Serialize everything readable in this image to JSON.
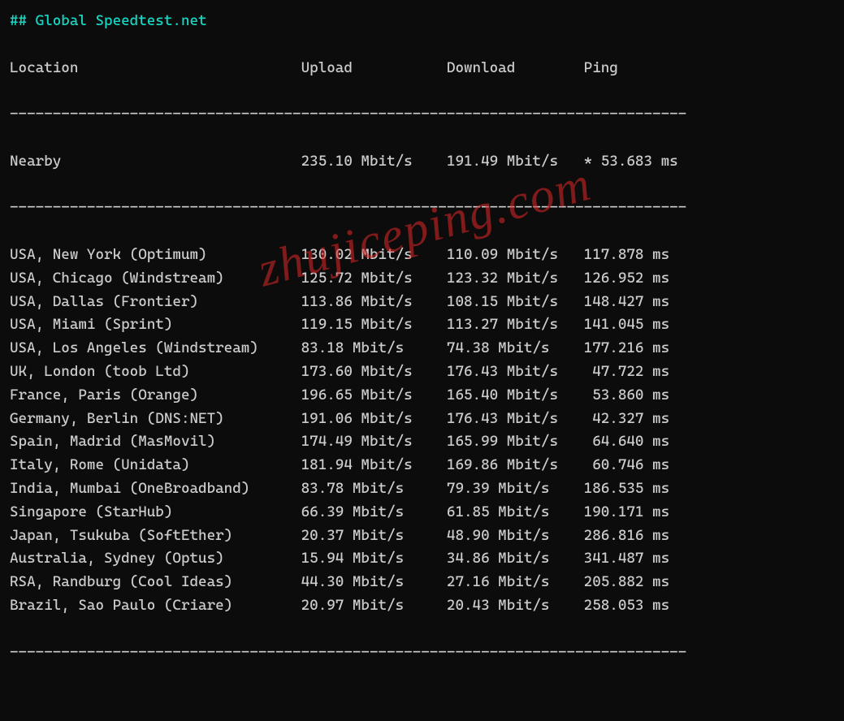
{
  "title": "## Global Speedtest.net",
  "headers": {
    "location": "Location",
    "upload": "Upload",
    "download": "Download",
    "ping": "Ping"
  },
  "nearby": {
    "location": "Nearby",
    "upload": "235.10 Mbit/s",
    "download": "191.49 Mbit/s",
    "ping": "* 53.683 ms"
  },
  "rows": [
    {
      "location": "USA, New York (Optimum)",
      "upload": "130.02 Mbit/s",
      "download": "110.09 Mbit/s",
      "ping": "117.878 ms"
    },
    {
      "location": "USA, Chicago (Windstream)",
      "upload": "125.72 Mbit/s",
      "download": "123.32 Mbit/s",
      "ping": "126.952 ms"
    },
    {
      "location": "USA, Dallas (Frontier)",
      "upload": "113.86 Mbit/s",
      "download": "108.15 Mbit/s",
      "ping": "148.427 ms"
    },
    {
      "location": "USA, Miami (Sprint)",
      "upload": "119.15 Mbit/s",
      "download": "113.27 Mbit/s",
      "ping": "141.045 ms"
    },
    {
      "location": "USA, Los Angeles (Windstream)",
      "upload": "83.18 Mbit/s",
      "download": "74.38 Mbit/s",
      "ping": "177.216 ms"
    },
    {
      "location": "UK, London (toob Ltd)",
      "upload": "173.60 Mbit/s",
      "download": "176.43 Mbit/s",
      "ping": " 47.722 ms"
    },
    {
      "location": "France, Paris (Orange)",
      "upload": "196.65 Mbit/s",
      "download": "165.40 Mbit/s",
      "ping": " 53.860 ms"
    },
    {
      "location": "Germany, Berlin (DNS:NET)",
      "upload": "191.06 Mbit/s",
      "download": "176.43 Mbit/s",
      "ping": " 42.327 ms"
    },
    {
      "location": "Spain, Madrid (MasMovil)",
      "upload": "174.49 Mbit/s",
      "download": "165.99 Mbit/s",
      "ping": " 64.640 ms"
    },
    {
      "location": "Italy, Rome (Unidata)",
      "upload": "181.94 Mbit/s",
      "download": "169.86 Mbit/s",
      "ping": " 60.746 ms"
    },
    {
      "location": "India, Mumbai (OneBroadband)",
      "upload": "83.78 Mbit/s",
      "download": "79.39 Mbit/s",
      "ping": "186.535 ms"
    },
    {
      "location": "Singapore (StarHub)",
      "upload": "66.39 Mbit/s",
      "download": "61.85 Mbit/s",
      "ping": "190.171 ms"
    },
    {
      "location": "Japan, Tsukuba (SoftEther)",
      "upload": "20.37 Mbit/s",
      "download": "48.90 Mbit/s",
      "ping": "286.816 ms"
    },
    {
      "location": "Australia, Sydney (Optus)",
      "upload": "15.94 Mbit/s",
      "download": "34.86 Mbit/s",
      "ping": "341.487 ms"
    },
    {
      "location": "RSA, Randburg (Cool Ideas)",
      "upload": "44.30 Mbit/s",
      "download": "27.16 Mbit/s",
      "ping": "205.882 ms"
    },
    {
      "location": "Brazil, Sao Paulo (Criare)",
      "upload": "20.97 Mbit/s",
      "download": "20.43 Mbit/s",
      "ping": "258.053 ms"
    }
  ],
  "watermark": "zhujiceping.com",
  "chart_data": {
    "type": "table",
    "title": "Global Speedtest.net",
    "columns": [
      "Location",
      "Upload (Mbit/s)",
      "Download (Mbit/s)",
      "Ping (ms)"
    ],
    "data": [
      [
        "Nearby",
        235.1,
        191.49,
        53.683
      ],
      [
        "USA, New York (Optimum)",
        130.02,
        110.09,
        117.878
      ],
      [
        "USA, Chicago (Windstream)",
        125.72,
        123.32,
        126.952
      ],
      [
        "USA, Dallas (Frontier)",
        113.86,
        108.15,
        148.427
      ],
      [
        "USA, Miami (Sprint)",
        119.15,
        113.27,
        141.045
      ],
      [
        "USA, Los Angeles (Windstream)",
        83.18,
        74.38,
        177.216
      ],
      [
        "UK, London (toob Ltd)",
        173.6,
        176.43,
        47.722
      ],
      [
        "France, Paris (Orange)",
        196.65,
        165.4,
        53.86
      ],
      [
        "Germany, Berlin (DNS:NET)",
        191.06,
        176.43,
        42.327
      ],
      [
        "Spain, Madrid (MasMovil)",
        174.49,
        165.99,
        64.64
      ],
      [
        "Italy, Rome (Unidata)",
        181.94,
        169.86,
        60.746
      ],
      [
        "India, Mumbai (OneBroadband)",
        83.78,
        79.39,
        186.535
      ],
      [
        "Singapore (StarHub)",
        66.39,
        61.85,
        190.171
      ],
      [
        "Japan, Tsukuba (SoftEther)",
        20.37,
        48.9,
        286.816
      ],
      [
        "Australia, Sydney (Optus)",
        15.94,
        34.86,
        341.487
      ],
      [
        "RSA, Randburg (Cool Ideas)",
        44.3,
        27.16,
        205.882
      ],
      [
        "Brazil, Sao Paulo (Criare)",
        20.97,
        20.43,
        258.053
      ]
    ]
  }
}
